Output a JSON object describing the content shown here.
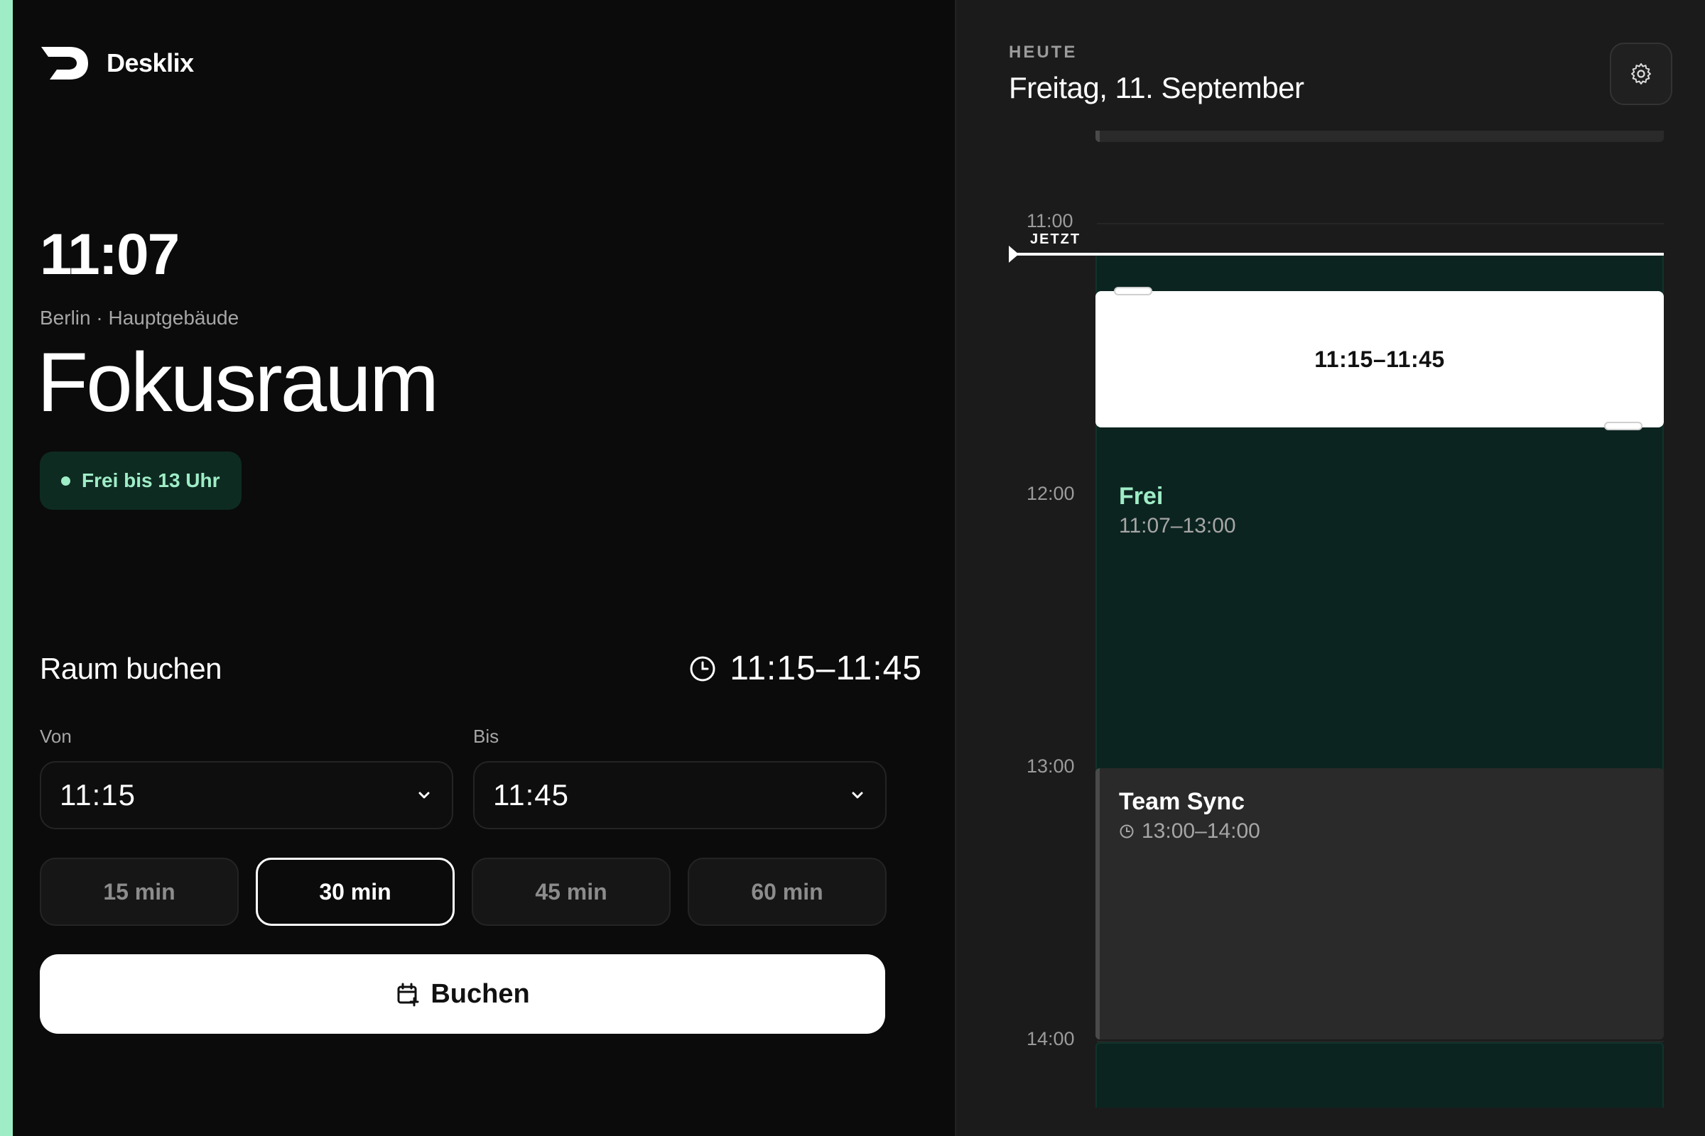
{
  "brand": {
    "name": "Desklix"
  },
  "colors": {
    "accent": "#9fedc7",
    "free_bg": "#0c2420",
    "busy_bg": "#2a2a2a",
    "background": "#0b0b0b",
    "panel": "#1b1b1b"
  },
  "room": {
    "time": "11:07",
    "location": "Berlin · Hauptgebäude",
    "name": "Fokusraum",
    "status": "Frei bis 13 Uhr"
  },
  "booking": {
    "title": "Raum buchen",
    "summary": "11:15–11:45",
    "from_label": "Von",
    "from_value": "11:15",
    "to_label": "Bis",
    "to_value": "11:45",
    "durations": [
      "15 min",
      "30 min",
      "45 min",
      "60 min"
    ],
    "selected_duration": "30 min",
    "button_label": "Buchen"
  },
  "calendar": {
    "today_label": "HEUTE",
    "date": "Freitag, 11. September",
    "hours": [
      "11:00",
      "12:00",
      "13:00",
      "14:00"
    ],
    "now_label": "JETZT",
    "selection_label": "11:15–11:45",
    "free_title": "Frei",
    "free_time": "11:07–13:00",
    "event_title": "Team Sync",
    "event_time": "13:00–14:00"
  }
}
